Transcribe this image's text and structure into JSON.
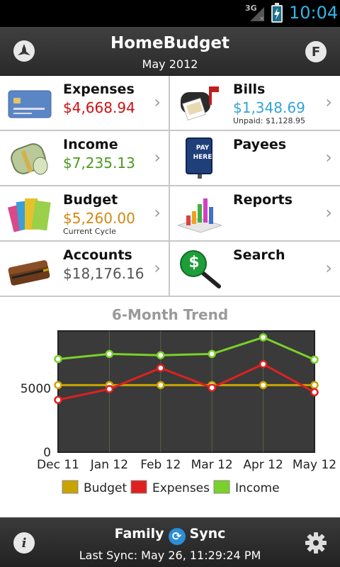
{
  "status_bar": {
    "network": "3G",
    "time": "10:04"
  },
  "header": {
    "title": "HomeBudget",
    "month": "May 2012",
    "right_button_label": "F"
  },
  "tiles": [
    {
      "name": "Expenses",
      "value": "$4,668.94",
      "value_color": "#cc1111",
      "sub": "",
      "icon": "credit-card-icon"
    },
    {
      "name": "Bills",
      "value": "$1,348.69",
      "value_color": "#33a3d6",
      "sub": "Unpaid: $1,128.95",
      "icon": "mailbox-icon"
    },
    {
      "name": "Income",
      "value": "$7,235.13",
      "value_color": "#4c9a1e",
      "sub": "",
      "icon": "money-roll-icon"
    },
    {
      "name": "Payees",
      "value": "",
      "value_color": "#333333",
      "sub": "",
      "icon": "pay-here-sign-icon",
      "icon_text": "PAY HERE"
    },
    {
      "name": "Budget",
      "value": "$5,260.00",
      "value_color": "#d08a10",
      "sub": "Current Cycle",
      "icon": "folders-icon"
    },
    {
      "name": "Reports",
      "value": "",
      "value_color": "#333333",
      "sub": "",
      "icon": "bar-chart-icon"
    },
    {
      "name": "Accounts",
      "value": "$18,176.16",
      "value_color": "#555555",
      "sub": "",
      "icon": "wallet-pen-icon"
    },
    {
      "name": "Search",
      "value": "",
      "value_color": "#333333",
      "sub": "",
      "icon": "dollar-magnifier-icon",
      "icon_text": "$"
    }
  ],
  "chevron": "›",
  "chart_data": {
    "type": "line",
    "title": "6-Month Trend",
    "categories": [
      "Dec 11",
      "Jan 12",
      "Feb 12",
      "Mar 12",
      "Apr 12",
      "May 12"
    ],
    "y_tick_labels": [
      "0",
      "5000"
    ],
    "ylim": [
      0,
      9500
    ],
    "grid": true,
    "legend_position": "bottom",
    "series": [
      {
        "name": "Budget",
        "color": "#c9a400",
        "values": [
          5260,
          5260,
          5260,
          5260,
          5260,
          5260
        ]
      },
      {
        "name": "Expenses",
        "color": "#e02020",
        "values": [
          4100,
          4950,
          6600,
          5050,
          6900,
          4700
        ]
      },
      {
        "name": "Income",
        "color": "#7ad12a",
        "values": [
          7300,
          7700,
          7600,
          7700,
          9000,
          7250
        ]
      }
    ]
  },
  "footer": {
    "sync_left": "Family",
    "sync_right": "Sync",
    "last_sync": "Last Sync: May 26, 11:29:24 PM"
  }
}
